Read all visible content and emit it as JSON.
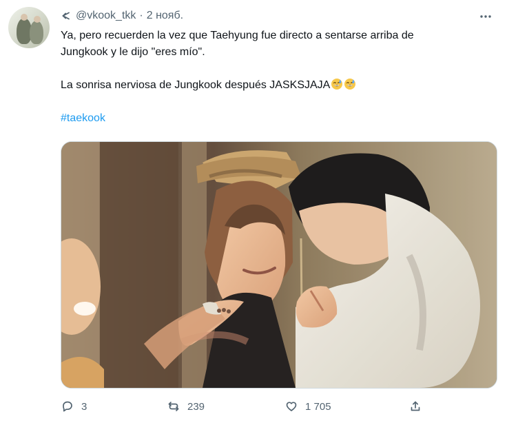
{
  "tweet": {
    "username": "@vkook_tkk",
    "separator": "·",
    "date": "2 нояб.",
    "text": {
      "line1": "Ya, pero recuerden la vez que Taehyung fue directo a sentarse arriba de",
      "line2": "Jungkook y le dijo \"eres mío\".",
      "line3": "La sonrisa nerviosa de Jungkook después JASKSJAJA",
      "hashtag": "#taekook"
    },
    "emoji": [
      "grinning-sweat-emoji",
      "grinning-sweat-emoji"
    ],
    "actions": {
      "reply_count": "3",
      "retweet_count": "239",
      "like_count": "1 705"
    },
    "icons": {
      "retweet_marker": "retweet-arrow-icon",
      "more": "more-horizontal-icon",
      "reply": "reply-icon",
      "retweet": "retweet-icon",
      "like": "heart-icon",
      "share": "share-icon"
    },
    "colors": {
      "text": "#0f1419",
      "secondary": "#536471",
      "link": "#1d9bf0",
      "border": "#cfd9de"
    }
  }
}
